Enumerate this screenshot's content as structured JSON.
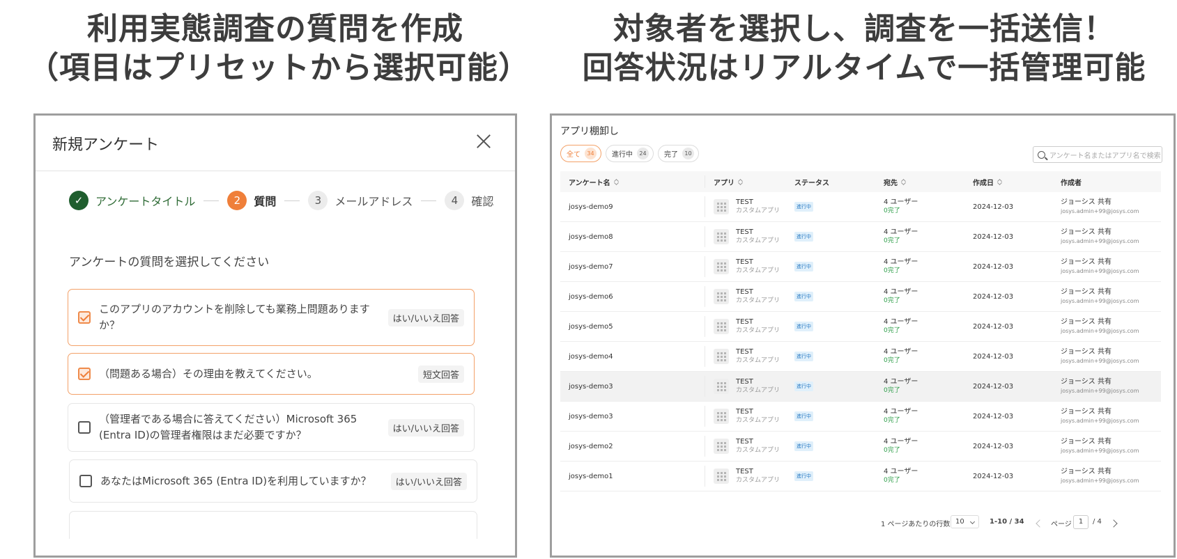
{
  "headlines": {
    "left": [
      "利用実態調査の質問を作成",
      "（項目はプリセットから選択可能）"
    ],
    "right": [
      "対象者を選択し、調査を一括送信！",
      "回答状況はリアルタイムで一括管理可能"
    ]
  },
  "modal": {
    "title": "新規アンケート",
    "close_icon": "close-icon",
    "steps": [
      {
        "num": "✓",
        "label": "アンケートタイトル",
        "state": "done"
      },
      {
        "num": "2",
        "label": "質問",
        "state": "active"
      },
      {
        "num": "3",
        "label": "メールアドレス",
        "state": "todo"
      },
      {
        "num": "4",
        "label": "確認",
        "state": "todo"
      }
    ],
    "prompt": "アンケートの質問を選択してください",
    "questions": [
      {
        "text": "このアプリのアカウントを削除しても業務上問題ありますか？",
        "type": "はい/いいえ回答",
        "checked": true
      },
      {
        "text": "（問題ある場合）その理由を教えてください。",
        "type": "短文回答",
        "checked": true
      },
      {
        "text": "（管理者である場合に答えてください）Microsoft 365 (Entra ID)の管理者権限はまだ必要ですか？",
        "type": "はい/いいえ回答",
        "checked": false
      },
      {
        "text": "あなたはMicrosoft 365 (Entra ID)を利用していますか？",
        "type": "はい/いいえ回答",
        "checked": false
      }
    ]
  },
  "survey_list": {
    "title": "アプリ棚卸し",
    "filters": [
      {
        "label": "全て",
        "count": "34",
        "active": true
      },
      {
        "label": "進行中",
        "count": "24",
        "active": false
      },
      {
        "label": "完了",
        "count": "10",
        "active": false
      }
    ],
    "search_placeholder": "アンケート名またはアプリ名で検索",
    "columns": [
      "アンケート名",
      "アプリ",
      "ステータス",
      "宛先",
      "作成日",
      "作成者"
    ],
    "rows": [
      {
        "name": "josys-demo9",
        "app": "TEST",
        "app_type": "カスタムアプリ",
        "status": "進行中",
        "recipients": "4 ユーザー",
        "completed": "0完了",
        "date": "2024-12-03",
        "creator": "ジョーシス 共有",
        "email": "josys.admin+99@josys.com"
      },
      {
        "name": "josys-demo8",
        "app": "TEST",
        "app_type": "カスタムアプリ",
        "status": "進行中",
        "recipients": "4 ユーザー",
        "completed": "0完了",
        "date": "2024-12-03",
        "creator": "ジョーシス 共有",
        "email": "josys.admin+99@josys.com"
      },
      {
        "name": "josys-demo7",
        "app": "TEST",
        "app_type": "カスタムアプリ",
        "status": "進行中",
        "recipients": "4 ユーザー",
        "completed": "0完了",
        "date": "2024-12-03",
        "creator": "ジョーシス 共有",
        "email": "josys.admin+99@josys.com"
      },
      {
        "name": "josys-demo6",
        "app": "TEST",
        "app_type": "カスタムアプリ",
        "status": "進行中",
        "recipients": "4 ユーザー",
        "completed": "0完了",
        "date": "2024-12-03",
        "creator": "ジョーシス 共有",
        "email": "josys.admin+99@josys.com"
      },
      {
        "name": "josys-demo5",
        "app": "TEST",
        "app_type": "カスタムアプリ",
        "status": "進行中",
        "recipients": "4 ユーザー",
        "completed": "0完了",
        "date": "2024-12-03",
        "creator": "ジョーシス 共有",
        "email": "josys.admin+99@josys.com"
      },
      {
        "name": "josys-demo4",
        "app": "TEST",
        "app_type": "カスタムアプリ",
        "status": "進行中",
        "recipients": "4 ユーザー",
        "completed": "0完了",
        "date": "2024-12-03",
        "creator": "ジョーシス 共有",
        "email": "josys.admin+99@josys.com"
      },
      {
        "name": "josys-demo3",
        "app": "TEST",
        "app_type": "カスタムアプリ",
        "status": "進行中",
        "recipients": "4 ユーザー",
        "completed": "0完了",
        "date": "2024-12-03",
        "creator": "ジョーシス 共有",
        "email": "josys.admin+99@josys.com",
        "highlight": true
      },
      {
        "name": "josys-demo3",
        "app": "TEST",
        "app_type": "カスタムアプリ",
        "status": "進行中",
        "recipients": "4 ユーザー",
        "completed": "0完了",
        "date": "2024-12-03",
        "creator": "ジョーシス 共有",
        "email": "josys.admin+99@josys.com"
      },
      {
        "name": "josys-demo2",
        "app": "TEST",
        "app_type": "カスタムアプリ",
        "status": "進行中",
        "recipients": "4 ユーザー",
        "completed": "0完了",
        "date": "2024-12-03",
        "creator": "ジョーシス 共有",
        "email": "josys.admin+99@josys.com"
      },
      {
        "name": "josys-demo1",
        "app": "TEST",
        "app_type": "カスタムアプリ",
        "status": "進行中",
        "recipients": "4 ユーザー",
        "completed": "0完了",
        "date": "2024-12-03",
        "creator": "ジョーシス 共有",
        "email": "josys.admin+99@josys.com"
      }
    ],
    "pagination": {
      "rows_per_page_label": "1 ページあたりの行数",
      "rows_per_page": "10",
      "range": "1-10 / 34",
      "page_label": "ページ",
      "current_page": "1",
      "total_pages": "/ 4"
    }
  },
  "colors": {
    "accent": "#ef7f3a",
    "done_green": "#1f5e2e",
    "status_blue": "#2b7cc4"
  }
}
